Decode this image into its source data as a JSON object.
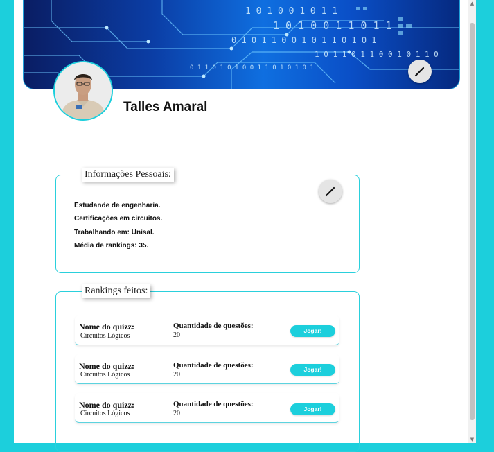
{
  "profile": {
    "name": "Talles Amaral"
  },
  "personal_info": {
    "legend": "Informações Pessoais:",
    "lines": [
      "Estudande de engenharia.",
      "Certificações em circuitos.",
      "Trabalhando em: Unisal.",
      "Média de rankings: 35."
    ]
  },
  "rankings": {
    "legend": "Rankings feitos:",
    "quiz_name_label": "Nome do quizz:",
    "question_count_label": "Quantidade de questões:",
    "play_label": "Jogar!",
    "items": [
      {
        "quiz_name": "Circuitos Lógicos",
        "question_count": "20"
      },
      {
        "quiz_name": "Circuitos Lógicos",
        "question_count": "20"
      },
      {
        "quiz_name": "Circuitos Lógicos",
        "question_count": "20"
      }
    ]
  },
  "icons": {
    "edit": "pencil-icon",
    "scroll_up": "arrow-up-icon",
    "scroll_down": "arrow-down-icon"
  },
  "colors": {
    "accent": "#1ccfdc",
    "banner": "#0b3ea6"
  }
}
